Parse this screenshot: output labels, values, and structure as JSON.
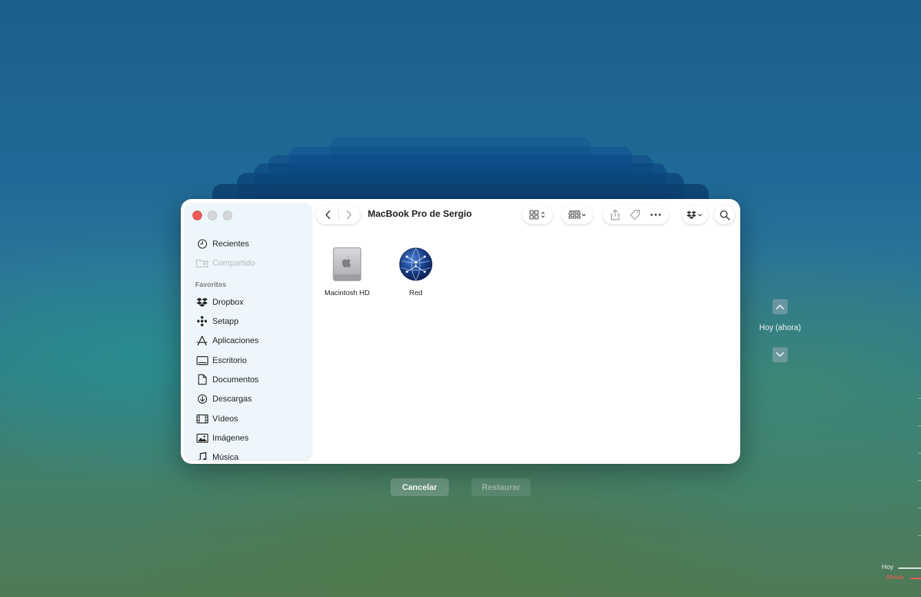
{
  "finder": {
    "title": "MacBook Pro de Sergio",
    "sidebar": {
      "recent": [
        {
          "label": "Recientes",
          "icon": "clock-icon",
          "enabled": true
        },
        {
          "label": "Compartido",
          "icon": "shared-folder-icon",
          "enabled": false
        }
      ],
      "favorites_heading": "Favoritos",
      "favorites": [
        {
          "label": "Dropbox",
          "icon": "dropbox-icon"
        },
        {
          "label": "Setapp",
          "icon": "setapp-icon"
        },
        {
          "label": "Aplicaciones",
          "icon": "applications-icon"
        },
        {
          "label": "Escritorio",
          "icon": "desktop-icon"
        },
        {
          "label": "Documentos",
          "icon": "document-icon"
        },
        {
          "label": "Descargas",
          "icon": "download-icon"
        },
        {
          "label": "Vídeos",
          "icon": "film-icon"
        },
        {
          "label": "Imágenes",
          "icon": "image-icon"
        },
        {
          "label": "Música",
          "icon": "music-note-icon"
        }
      ]
    },
    "items": [
      {
        "label": "Macintosh HD",
        "icon": "hard-drive-icon"
      },
      {
        "label": "Red",
        "icon": "network-globe-icon"
      }
    ]
  },
  "time_machine": {
    "current_label": "Hoy (ahora)",
    "cancel_label": "Cancelar",
    "restore_label": "Restaurar",
    "timeline_today": "Hoy",
    "timeline_now": "Ahora"
  },
  "colors": {
    "close_button": "#ee5c58",
    "now_marker": "#ff5a50",
    "sidebar_bg": "#edf6fb"
  }
}
